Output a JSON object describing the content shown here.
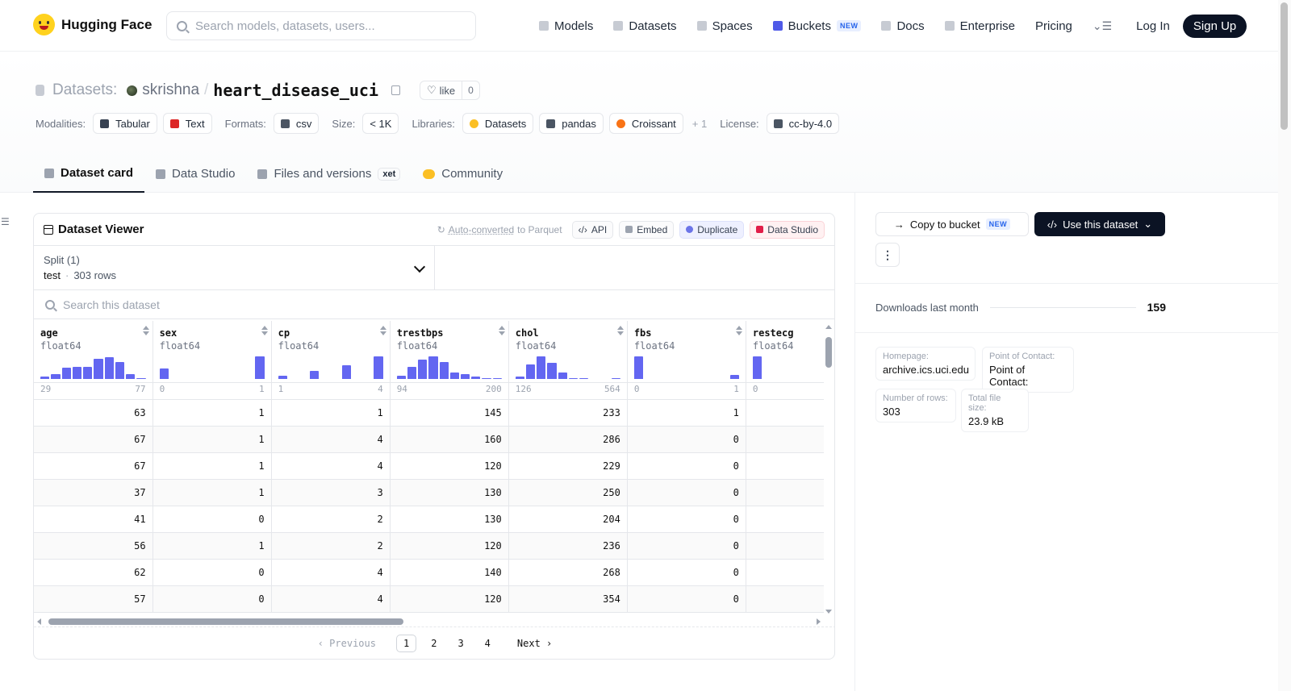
{
  "header": {
    "brand": "Hugging Face",
    "search_placeholder": "Search models, datasets, users...",
    "nav": [
      {
        "label": "Models",
        "icon": "cube-icon"
      },
      {
        "label": "Datasets",
        "icon": "database-icon"
      },
      {
        "label": "Spaces",
        "icon": "grid-icon"
      },
      {
        "label": "Buckets",
        "icon": "bucket-icon",
        "badge": "NEW"
      },
      {
        "label": "Docs",
        "icon": "book-icon"
      },
      {
        "label": "Enterprise",
        "icon": "enterprise-icon"
      },
      {
        "label": "Pricing"
      }
    ],
    "login": "Log In",
    "signup": "Sign Up"
  },
  "repo": {
    "section": "Datasets:",
    "owner": "skrishna",
    "slash": "/",
    "name": "heart_disease_uci",
    "like_label": "like",
    "like_count": "0"
  },
  "tags": {
    "modalities_label": "Modalities:",
    "modalities": [
      "Tabular",
      "Text"
    ],
    "formats_label": "Formats:",
    "formats": [
      "csv"
    ],
    "size_label": "Size:",
    "size": "< 1K",
    "libraries_label": "Libraries:",
    "libraries": [
      "Datasets",
      "pandas",
      "Croissant"
    ],
    "libraries_more": "+ 1",
    "license_label": "License:",
    "license": "cc-by-4.0"
  },
  "tabs": [
    {
      "label": "Dataset card",
      "active": true
    },
    {
      "label": "Data Studio"
    },
    {
      "label": "Files and versions",
      "badge": "xet"
    },
    {
      "label": "Community"
    }
  ],
  "viewer": {
    "title": "Dataset Viewer",
    "auto_converted": "Auto-converted",
    "to_parquet": "to Parquet",
    "buttons": [
      "API",
      "Embed",
      "Duplicate",
      "Data Studio"
    ],
    "split_label": "Split (1)",
    "split_value": "test",
    "split_dot": "·",
    "split_rows": "303 rows",
    "search_placeholder": "Search this dataset",
    "columns": [
      {
        "name": "age",
        "type": "float64",
        "min": "29",
        "max": "77",
        "hist": [
          0.1,
          0.2,
          0.5,
          0.55,
          0.55,
          0.9,
          0.95,
          0.75,
          0.2,
          0.05
        ]
      },
      {
        "name": "sex",
        "type": "float64",
        "min": "0",
        "max": "1",
        "hist": [
          0.45,
          0,
          0,
          0,
          0,
          0,
          0,
          0,
          0,
          1
        ]
      },
      {
        "name": "cp",
        "type": "float64",
        "min": "1",
        "max": "4",
        "hist": [
          0.15,
          0,
          0,
          0.35,
          0,
          0,
          0.6,
          0,
          0,
          1
        ]
      },
      {
        "name": "trestbps",
        "type": "float64",
        "min": "94",
        "max": "200",
        "hist": [
          0.15,
          0.55,
          0.85,
          1,
          0.75,
          0.3,
          0.2,
          0.1,
          0.05,
          0.05
        ]
      },
      {
        "name": "chol",
        "type": "float64",
        "min": "126",
        "max": "564",
        "hist": [
          0.1,
          0.65,
          1,
          0.7,
          0.3,
          0.05,
          0.05,
          0,
          0,
          0.02
        ]
      },
      {
        "name": "fbs",
        "type": "float64",
        "min": "0",
        "max": "1",
        "hist": [
          1,
          0,
          0,
          0,
          0,
          0,
          0,
          0,
          0,
          0.18
        ]
      },
      {
        "name": "restecg",
        "type": "float64",
        "min": "0",
        "max": "",
        "hist": [
          1,
          0,
          0,
          0,
          0,
          0,
          0,
          0.05,
          0,
          0
        ]
      }
    ],
    "rows": [
      [
        "63",
        "1",
        "1",
        "145",
        "233",
        "1",
        ""
      ],
      [
        "67",
        "1",
        "4",
        "160",
        "286",
        "0",
        ""
      ],
      [
        "67",
        "1",
        "4",
        "120",
        "229",
        "0",
        ""
      ],
      [
        "37",
        "1",
        "3",
        "130",
        "250",
        "0",
        ""
      ],
      [
        "41",
        "0",
        "2",
        "130",
        "204",
        "0",
        ""
      ],
      [
        "56",
        "1",
        "2",
        "120",
        "236",
        "0",
        ""
      ],
      [
        "62",
        "0",
        "4",
        "140",
        "268",
        "0",
        ""
      ],
      [
        "57",
        "0",
        "4",
        "120",
        "354",
        "0",
        ""
      ]
    ],
    "pager": {
      "prev": "‹ Previous",
      "pages": [
        "1",
        "2",
        "3",
        "4"
      ],
      "active": "1",
      "next": "Next ›"
    }
  },
  "sidebar": {
    "copy_bucket": "Copy to bucket",
    "copy_bucket_badge": "NEW",
    "use_dataset": "Use this dataset",
    "more": "⋮",
    "downloads_label": "Downloads last month",
    "downloads_value": "159",
    "info": [
      {
        "key": "Homepage:",
        "value": "archive.ics.uci.edu"
      },
      {
        "key": "Point of Contact:",
        "value": "Point of Contact:"
      },
      {
        "key": "Number of rows:",
        "value": "303"
      },
      {
        "key": "Total file size:",
        "value": "23.9 kB"
      }
    ]
  },
  "colors": {
    "accent": "#6366f1",
    "dark": "#0b1324",
    "muted": "#9ca3af"
  }
}
